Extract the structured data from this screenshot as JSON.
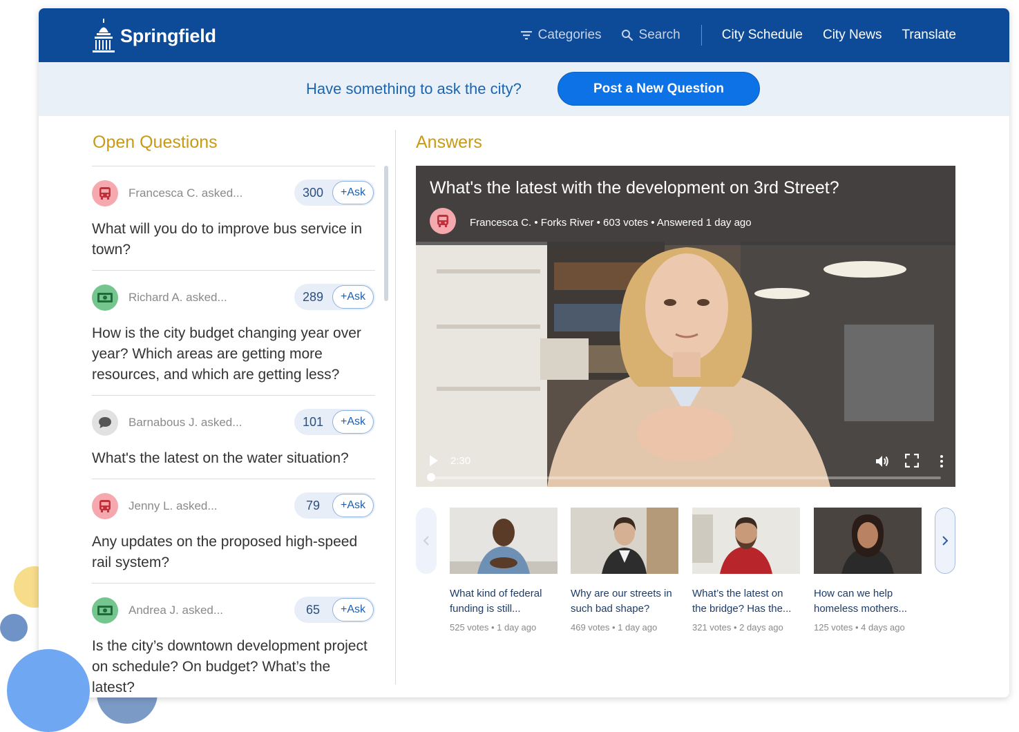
{
  "brand": {
    "name": "Springfield",
    "logo_icon": "capitol-dome-icon"
  },
  "nav": {
    "categories": "Categories",
    "search": "Search",
    "city_schedule": "City Schedule",
    "city_news": "City News",
    "translate": "Translate"
  },
  "ask_banner": {
    "prompt": "Have something to ask the city?",
    "button": "Post a New Question"
  },
  "open_questions": {
    "title": "Open Questions",
    "items": [
      {
        "author": "Francesca C. asked...",
        "votes": "300",
        "ask": "+Ask",
        "icon": "bus-icon",
        "text": "What will you do to improve bus service in town?"
      },
      {
        "author": "Richard A. asked...",
        "votes": "289",
        "ask": "+Ask",
        "icon": "money-icon",
        "text": "How is the city budget changing year over year? Which areas are getting more resources, and which are getting less?"
      },
      {
        "author": "Barnabous J. asked...",
        "votes": "101",
        "ask": "+Ask",
        "icon": "chat-icon",
        "text": "What's the latest on the water situation?"
      },
      {
        "author": "Jenny L. asked...",
        "votes": "79",
        "ask": "+Ask",
        "icon": "bus-icon",
        "text": "Any updates on the proposed high-speed rail system?"
      },
      {
        "author": "Andrea J. asked...",
        "votes": "65",
        "ask": "+Ask",
        "icon": "money-icon",
        "text": "Is the city’s downtown development project on schedule? On budget? What’s the latest?"
      }
    ]
  },
  "answers": {
    "title": "Answers",
    "video": {
      "title": "What's the latest with the development on 3rd Street?",
      "meta": "Francesca C. • Forks River • 603 votes • Answered 1 day ago",
      "time": "2:30",
      "progress": 0.0
    },
    "related": [
      {
        "caption": "What kind of federal funding is still...",
        "meta": "525 votes • 1 day ago"
      },
      {
        "caption": "Why are our streets in such bad shape?",
        "meta": "469 votes • 1 day ago"
      },
      {
        "caption": "What’s the latest on the bridge? Has the...",
        "meta": "321 votes • 2 days ago"
      },
      {
        "caption": "How can we help homeless mothers...",
        "meta": "125 votes • 4 days ago"
      }
    ]
  },
  "colors": {
    "header": "#0d4a97",
    "accent": "#0c72e5",
    "section_title": "#c99a13",
    "ask_text": "#1b66b1"
  }
}
